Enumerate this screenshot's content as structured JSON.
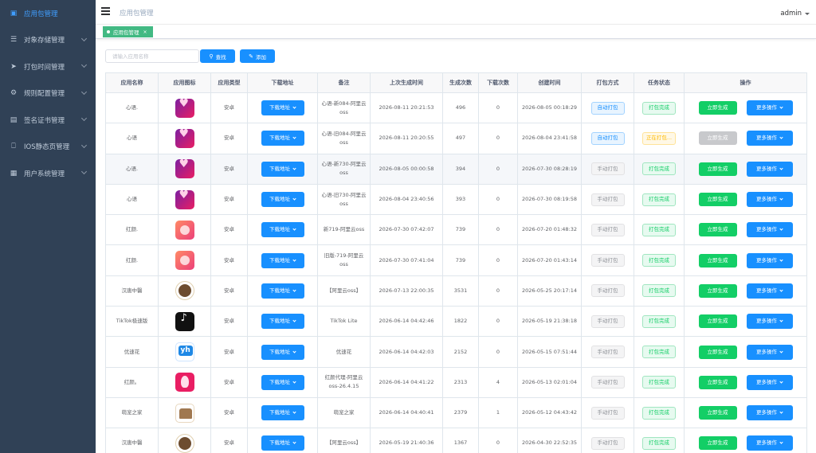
{
  "sidebar": {
    "items": [
      {
        "label": "应用包管理",
        "icon": "app-package-icon",
        "active": true
      },
      {
        "label": "对象存储管理",
        "icon": "list-icon"
      },
      {
        "label": "打包时间管理",
        "icon": "send-icon"
      },
      {
        "label": "规则配置管理",
        "icon": "gear-icon"
      },
      {
        "label": "签名证书管理",
        "icon": "certificate-icon"
      },
      {
        "label": "IOS静态页管理",
        "icon": "ios-icon"
      },
      {
        "label": "用户系统管理",
        "icon": "grid-icon"
      }
    ]
  },
  "navbar": {
    "breadcrumb": "应用包管理",
    "user": "admin"
  },
  "tagsview": {
    "tag": "应用包管理",
    "close": "×"
  },
  "search": {
    "placeholder": "请输入应用名称",
    "search_label": "查找",
    "add_label": "添加"
  },
  "table": {
    "headers": [
      "应用名称",
      "应用图标",
      "应用类型",
      "下载地址",
      "备注",
      "上次生成时间",
      "生成次数",
      "下载次数",
      "创建时间",
      "打包方式",
      "任务状态",
      "操作"
    ],
    "download_label": "下载地址",
    "generate_label": "立即生成",
    "more_label": "更多操作",
    "rows": [
      {
        "name": "心语.",
        "icon": "xinyu",
        "type": "安卓",
        "remark": "心语-新084-阿里云oss",
        "last_gen": "2026-08-11 20:21:53",
        "gen_count": "496",
        "dl_count": "0",
        "created": "2026-08-05 00:18:29",
        "pack": "自动打包",
        "pack_mode": "auto",
        "status": "打包完成",
        "status_mode": "done",
        "gen_disabled": false
      },
      {
        "name": "心语",
        "icon": "xinyu",
        "type": "安卓",
        "remark": "心语-旧084-阿里云oss",
        "last_gen": "2026-08-11 20:20:55",
        "gen_count": "497",
        "dl_count": "0",
        "created": "2026-08-04 23:41:58",
        "pack": "自动打包",
        "pack_mode": "auto",
        "status": "正在打包...",
        "status_mode": "run",
        "gen_disabled": true
      },
      {
        "name": "心语.",
        "icon": "xinyu",
        "type": "安卓",
        "remark": "心语-新730-阿里云oss",
        "last_gen": "2026-08-05 00:00:58",
        "gen_count": "394",
        "dl_count": "0",
        "created": "2026-07-30 08:28:19",
        "pack": "手动打包",
        "pack_mode": "manual",
        "status": "打包完成",
        "status_mode": "done",
        "gen_disabled": false,
        "highlight": true
      },
      {
        "name": "心语",
        "icon": "xinyu",
        "type": "安卓",
        "remark": "心语-旧730-阿里云oss",
        "last_gen": "2026-08-04 23:40:56",
        "gen_count": "393",
        "dl_count": "0",
        "created": "2026-07-30 08:19:58",
        "pack": "手动打包",
        "pack_mode": "manual",
        "status": "打包完成",
        "status_mode": "done",
        "gen_disabled": false
      },
      {
        "name": "红颜.",
        "icon": "hongyan",
        "type": "安卓",
        "remark": "新719-阿里云oss",
        "last_gen": "2026-07-30 07:42:07",
        "gen_count": "739",
        "dl_count": "0",
        "created": "2026-07-20 01:48:32",
        "pack": "手动打包",
        "pack_mode": "manual",
        "status": "打包完成",
        "status_mode": "done",
        "gen_disabled": false
      },
      {
        "name": "红颜.",
        "icon": "hongyan",
        "type": "安卓",
        "remark": "旧版-719-阿里云oss",
        "last_gen": "2026-07-30 07:41:04",
        "gen_count": "739",
        "dl_count": "0",
        "created": "2026-07-20 01:43:14",
        "pack": "手动打包",
        "pack_mode": "manual",
        "status": "打包完成",
        "status_mode": "done",
        "gen_disabled": false
      },
      {
        "name": "汉唐中醫",
        "icon": "hantang",
        "type": "安卓",
        "remark": "【阿里云oss】",
        "last_gen": "2026-07-13 22:00:35",
        "gen_count": "3531",
        "dl_count": "0",
        "created": "2026-05-25 20:17:14",
        "pack": "手动打包",
        "pack_mode": "manual",
        "status": "打包完成",
        "status_mode": "done",
        "gen_disabled": false
      },
      {
        "name": "TikTok极速版",
        "icon": "tiktok",
        "type": "安卓",
        "remark": "TikTok Lite",
        "last_gen": "2026-06-14 04:42:46",
        "gen_count": "1822",
        "dl_count": "0",
        "created": "2026-05-19 21:38:18",
        "pack": "手动打包",
        "pack_mode": "manual",
        "status": "打包完成",
        "status_mode": "done",
        "gen_disabled": false
      },
      {
        "name": "优速花",
        "icon": "you",
        "type": "安卓",
        "remark": "优速花",
        "last_gen": "2026-06-14 04:42:03",
        "gen_count": "2152",
        "dl_count": "0",
        "created": "2026-05-15 07:51:44",
        "pack": "手动打包",
        "pack_mode": "manual",
        "status": "打包完成",
        "status_mode": "done",
        "gen_disabled": false
      },
      {
        "name": "红颜。",
        "icon": "hongyan2",
        "type": "安卓",
        "remark": "红颜代理-阿里云oss-26.4.15",
        "last_gen": "2026-06-14 04:41:22",
        "gen_count": "2313",
        "dl_count": "4",
        "created": "2026-05-13 02:01:04",
        "pack": "手动打包",
        "pack_mode": "manual",
        "status": "打包完成",
        "status_mode": "done",
        "gen_disabled": false
      },
      {
        "name": "萌宠之家",
        "icon": "mengchong",
        "type": "安卓",
        "remark": "萌宠之家",
        "last_gen": "2026-06-14 04:40:41",
        "gen_count": "2379",
        "dl_count": "1",
        "created": "2026-05-12 04:43:42",
        "pack": "手动打包",
        "pack_mode": "manual",
        "status": "打包完成",
        "status_mode": "done",
        "gen_disabled": false
      },
      {
        "name": "汉唐中醫",
        "icon": "hantang",
        "type": "安卓",
        "remark": "【阿里云oss】",
        "last_gen": "2026-05-19 21:40:36",
        "gen_count": "1367",
        "dl_count": "0",
        "created": "2026-04-30 22:52:35",
        "pack": "手动打包",
        "pack_mode": "manual",
        "status": "打包完成",
        "status_mode": "done",
        "gen_disabled": false
      }
    ]
  }
}
